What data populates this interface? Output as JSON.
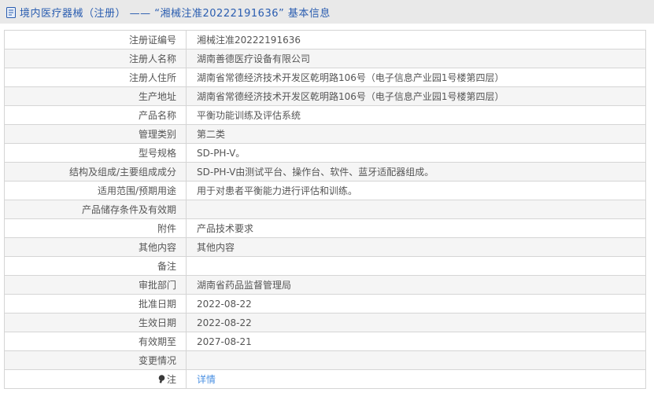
{
  "header": {
    "title": "境内医疗器械（注册） ——  “湘械注准20222191636”  基本信息"
  },
  "table": {
    "rows": [
      {
        "label": "注册证编号",
        "value": "湘械注准20222191636"
      },
      {
        "label": "注册人名称",
        "value": "湖南善德医疗设备有限公司"
      },
      {
        "label": "注册人住所",
        "value": "湖南省常德经济技术开发区乾明路106号（电子信息产业园1号楼第四层）"
      },
      {
        "label": "生产地址",
        "value": "湖南省常德经济技术开发区乾明路106号（电子信息产业园1号楼第四层）"
      },
      {
        "label": "产品名称",
        "value": "平衡功能训练及评估系统"
      },
      {
        "label": "管理类别",
        "value": "第二类"
      },
      {
        "label": "型号规格",
        "value": "SD-PH-V。"
      },
      {
        "label": "结构及组成/主要组成成分",
        "value": "SD-PH-V由测试平台、操作台、软件、蓝牙适配器组成。"
      },
      {
        "label": "适用范围/预期用途",
        "value": "用于对患者平衡能力进行评估和训练。"
      },
      {
        "label": "产品储存条件及有效期",
        "value": ""
      },
      {
        "label": "附件",
        "value": "产品技术要求"
      },
      {
        "label": "其他内容",
        "value": "其他内容"
      },
      {
        "label": "备注",
        "value": ""
      },
      {
        "label": "审批部门",
        "value": "湖南省药品监督管理局"
      },
      {
        "label": "批准日期",
        "value": "2022-08-22"
      },
      {
        "label": "生效日期",
        "value": "2022-08-22"
      },
      {
        "label": "有效期至",
        "value": "2027-08-21"
      },
      {
        "label": "变更情况",
        "value": ""
      },
      {
        "label": "注",
        "value": "详情",
        "link": true,
        "label_icon": "lightbulb-icon"
      }
    ]
  },
  "colors": {
    "accent_blue": "#2a5db0",
    "link_blue": "#4a90e2",
    "header_bg": "#e9e9e9",
    "row_alt_bg": "#f5f5f5",
    "border": "#d5d5d5"
  }
}
